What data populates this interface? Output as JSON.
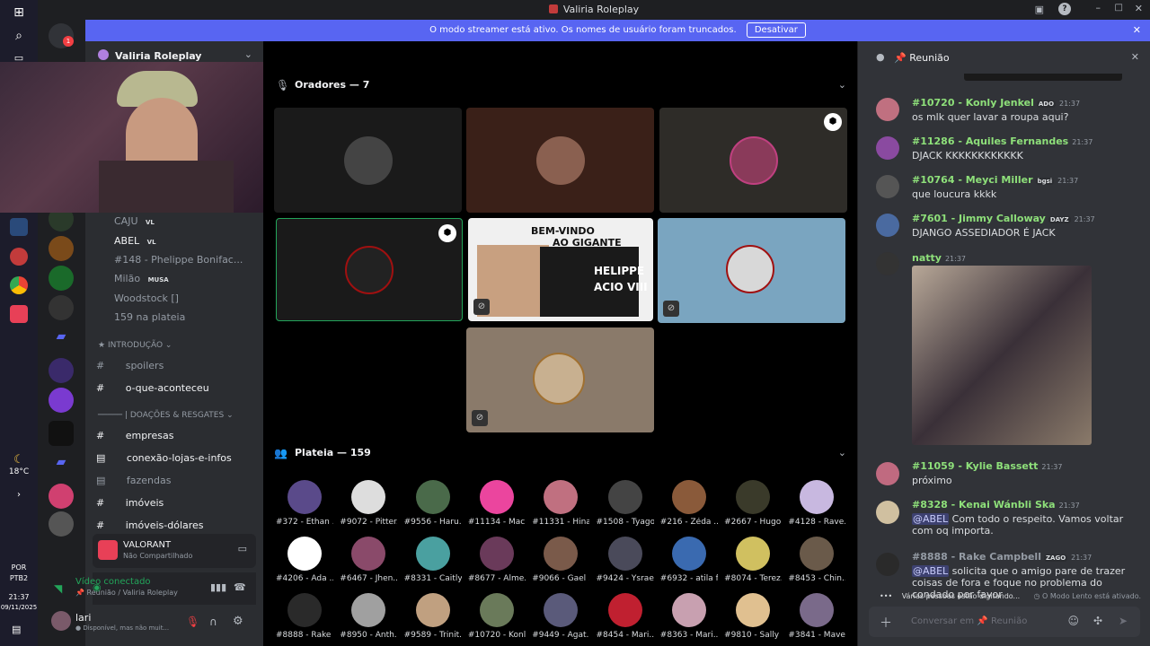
{
  "window": {
    "title": "Valiria Roleplay"
  },
  "streamer_notice": {
    "text": "O modo streamer está ativo. Os nomes de usuário foram truncados.",
    "button": "Desativar"
  },
  "server": {
    "name": "Valiria Roleplay"
  },
  "taskbar": {
    "weather_temp": "18°C",
    "lang": "POR",
    "lang2": "PTB2",
    "time": "21:37",
    "date": "09/11/2025"
  },
  "stage_members": [
    {
      "name": "CAJU",
      "badge": "VL"
    },
    {
      "name": "ABEL",
      "badge": "VL"
    },
    {
      "name": "#148 - Phelippe Bonifac..."
    },
    {
      "name": "Milão",
      "badge": "MUSA"
    },
    {
      "name": "Woodstock []"
    },
    {
      "name": "159 na plateia"
    }
  ],
  "channels": [
    {
      "label": "INTRODUÇÃO",
      "type": "category"
    },
    {
      "label": "spoilers",
      "type": "text"
    },
    {
      "label": "o-que-aconteceu",
      "type": "text",
      "bright": true
    },
    {
      "label": "| DOAÇÕES & RESGATES",
      "type": "category"
    },
    {
      "label": "empresas",
      "type": "text",
      "bright": true
    },
    {
      "label": "conexão-lojas-e-infos",
      "type": "text",
      "bright": true
    },
    {
      "label": "fazendas",
      "type": "text"
    },
    {
      "label": "imóveis",
      "type": "text",
      "bright": true
    },
    {
      "label": "imóveis-dólares",
      "type": "text",
      "bright": true
    }
  ],
  "activity": {
    "game": "VALORANT",
    "status": "Não Compartilhado"
  },
  "voice": {
    "status": "Vídeo conectado",
    "location": "Reunião / Valiria Roleplay"
  },
  "user": {
    "name": "lari",
    "status": "Disponível, mas não muit..."
  },
  "stage": {
    "speakers_title": "Oradores — 7",
    "audience_title": "Plateia — 159",
    "banner_line1": "BEM-VINDO",
    "banner_line2": "AO GIGANTE",
    "banner_line3": "HELIPPE",
    "banner_line4": "ACIO VIII"
  },
  "audience": [
    "#372 - Ethan ...",
    "#9072 - Pitter...",
    "#9556 - Haru...",
    "#11134 - Maci...",
    "#11331 - Hinai...",
    "#1508 - Tyago...",
    "#216 - Zéda ...",
    "#2667 - Hugo ...",
    "#4128 - Rave...",
    "#4206 - Ada ...",
    "#6467 - Jhen...",
    "#8331 - Caitly...",
    "#8677 - Alme...",
    "#9066 - Gael ...",
    "#9424 - Ysrae...",
    "#6932 - atila f...",
    "#8074 - Terez...",
    "#8453 - Chin...",
    "#8888 - Rake ...",
    "#8950 - Anth...",
    "#9589 - Trinit...",
    "#10720 - Konl...",
    "#9449 - Agat...",
    "#8454 - Mari...",
    "#8363 - Mari...",
    "#9810 - Sally ...",
    "#3841 - Mave..."
  ],
  "chat": {
    "title": "Reunião",
    "messages": [
      {
        "name": "#10720 - Konly Jenkel",
        "badge": "ADO",
        "time": "21:37",
        "text": "os mlk quer lavar a roupa aqui?"
      },
      {
        "name": "#11286 - Aquiles Fernandes",
        "time": "21:37",
        "text": "DJACK KKKKKKKKKKKK"
      },
      {
        "name": "#10764 - Meyci Miller",
        "badge": "bgsi",
        "time": "21:37",
        "text": "que loucura kkkk"
      },
      {
        "name": "#7601 - Jimmy Calloway",
        "badge": "DAYZ",
        "time": "21:37",
        "text": "DJANGO ASSEDIADOR É JACK"
      },
      {
        "name": "natty",
        "time": "21:37",
        "text": ""
      },
      {
        "name": "#11059 - Kylie Bassett",
        "time": "21:37",
        "text": "próximo"
      },
      {
        "name": "#8328 - Kenai Wánbli Ska",
        "time": "21:37",
        "mention": "@ABEL",
        "text": "Com todo o respeito. Vamos voltar com oq importa."
      },
      {
        "name": "#8888 - Rake Campbell",
        "badge": "ZAGO",
        "time": "21:37",
        "mention": "@ABEL",
        "text": "solicita que o amigo pare de trazer coisas de fora e foque no problema do condado por favor"
      }
    ],
    "typing": "Várias pessoas estão digitando...",
    "slow_mode": "O Modo Lento está ativado.",
    "input_placeholder": "Conversar em",
    "input_channel": "Reunião"
  }
}
